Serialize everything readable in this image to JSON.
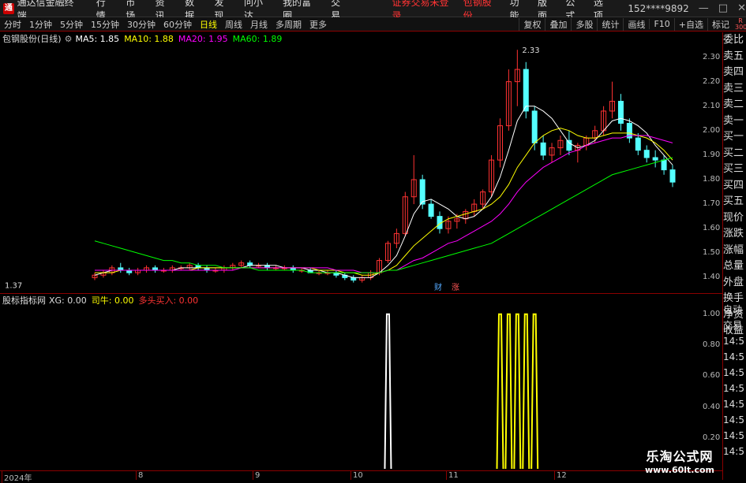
{
  "menubar": {
    "app_name": "通达信金融终端",
    "items": [
      "行情",
      "市场",
      "资讯",
      "数据",
      "发现",
      "问小达",
      "我的富圈",
      "交易"
    ],
    "login_status": "证券交易未登录",
    "stock_name": "包钢股份",
    "right_items": [
      "功能",
      "版面",
      "公式",
      "选项"
    ],
    "phone": "152****9892",
    "window_buttons": [
      "—",
      "□",
      "✕"
    ]
  },
  "tabbar": {
    "periods": [
      "分时",
      "1分钟",
      "5分钟",
      "15分钟",
      "30分钟",
      "60分钟",
      "日线",
      "周线",
      "月线",
      "多周期",
      "更多"
    ],
    "active_period": "日线",
    "tools": [
      "复权",
      "叠加",
      "多股",
      "统计",
      "画线",
      "F10",
      "+自选",
      "标记"
    ],
    "badge": "R 300"
  },
  "main_info": {
    "title": "包钢股份(日线)",
    "ma5": "MA5: 1.85",
    "ma10": "MA10: 1.88",
    "ma20": "MA20: 1.95",
    "ma60": "MA60: 1.89"
  },
  "sub_info": {
    "title": "股标指标网",
    "xg": "XG: 0.00",
    "siniu": "司牛: 0.00",
    "duotou": "多头买入: 0.00"
  },
  "annotations": {
    "high_label": "2.33",
    "low_label": "1.37",
    "cai": "财",
    "zhang": "涨"
  },
  "right_panel": {
    "items": [
      "委比",
      "卖五",
      "卖四",
      "卖三",
      "卖二",
      "卖一",
      "买一",
      "买二",
      "买三",
      "买四",
      "买五",
      "现价",
      "涨跌",
      "涨幅",
      "总量",
      "外盘",
      "换手",
      "净资",
      "收益"
    ],
    "sub_items": [
      "自动",
      "交易",
      "14:5",
      "14:5",
      "14:5",
      "14:5",
      "14:5",
      "14:5",
      "14:5",
      "14:5",
      "14:5"
    ]
  },
  "colors": {
    "up": "#ff3232",
    "down": "#54ffff",
    "ma5": "#ffffff",
    "ma10": "#ffff00",
    "ma20": "#ff00ff",
    "ma60": "#00ff00"
  },
  "y_main": [
    "2.30",
    "2.20",
    "2.10",
    "2.00",
    "1.90",
    "1.80",
    "1.70",
    "1.60",
    "1.50",
    "1.40"
  ],
  "y_sub": [
    "1.00",
    "0.80",
    "0.60",
    "0.40",
    "0.20"
  ],
  "x_axis": [
    "2024年",
    "8",
    "9",
    "10",
    "11",
    "12"
  ],
  "watermark": {
    "line1": "乐淘公式网",
    "line2": "www.60lt.com"
  },
  "chart_data": [
    {
      "type": "candlestick",
      "title": "包钢股份(日线)",
      "ylim": [
        1.34,
        2.35
      ],
      "x_labels": [
        "2024年",
        "8",
        "9",
        "10",
        "11",
        "12"
      ],
      "series": [
        {
          "name": "K线",
          "values": [
            [
              1.4,
              1.42,
              1.39,
              1.41
            ],
            [
              1.41,
              1.43,
              1.4,
              1.42
            ],
            [
              1.42,
              1.45,
              1.41,
              1.44
            ],
            [
              1.44,
              1.46,
              1.42,
              1.43
            ],
            [
              1.43,
              1.44,
              1.41,
              1.42
            ],
            [
              1.42,
              1.44,
              1.41,
              1.43
            ],
            [
              1.43,
              1.45,
              1.42,
              1.44
            ],
            [
              1.44,
              1.45,
              1.42,
              1.43
            ],
            [
              1.43,
              1.44,
              1.42,
              1.43
            ],
            [
              1.43,
              1.45,
              1.42,
              1.44
            ],
            [
              1.44,
              1.45,
              1.43,
              1.44
            ],
            [
              1.44,
              1.46,
              1.43,
              1.45
            ],
            [
              1.45,
              1.46,
              1.43,
              1.44
            ],
            [
              1.44,
              1.45,
              1.42,
              1.43
            ],
            [
              1.43,
              1.44,
              1.42,
              1.43
            ],
            [
              1.43,
              1.45,
              1.42,
              1.44
            ],
            [
              1.44,
              1.46,
              1.43,
              1.45
            ],
            [
              1.45,
              1.47,
              1.44,
              1.46
            ],
            [
              1.46,
              1.47,
              1.44,
              1.45
            ],
            [
              1.45,
              1.46,
              1.44,
              1.45
            ],
            [
              1.45,
              1.46,
              1.43,
              1.44
            ],
            [
              1.44,
              1.45,
              1.43,
              1.44
            ],
            [
              1.44,
              1.45,
              1.43,
              1.44
            ],
            [
              1.44,
              1.45,
              1.42,
              1.43
            ],
            [
              1.43,
              1.44,
              1.42,
              1.43
            ],
            [
              1.43,
              1.44,
              1.42,
              1.42
            ],
            [
              1.42,
              1.43,
              1.41,
              1.42
            ],
            [
              1.42,
              1.43,
              1.41,
              1.42
            ],
            [
              1.42,
              1.43,
              1.4,
              1.41
            ],
            [
              1.41,
              1.42,
              1.39,
              1.4
            ],
            [
              1.4,
              1.41,
              1.38,
              1.39
            ],
            [
              1.39,
              1.41,
              1.38,
              1.4
            ],
            [
              1.4,
              1.43,
              1.39,
              1.42
            ],
            [
              1.42,
              1.48,
              1.41,
              1.47
            ],
            [
              1.47,
              1.55,
              1.46,
              1.54
            ],
            [
              1.54,
              1.6,
              1.52,
              1.58
            ],
            [
              1.58,
              1.75,
              1.57,
              1.73
            ],
            [
              1.73,
              1.9,
              1.7,
              1.8
            ],
            [
              1.8,
              1.82,
              1.68,
              1.7
            ],
            [
              1.7,
              1.72,
              1.64,
              1.65
            ],
            [
              1.65,
              1.67,
              1.58,
              1.6
            ],
            [
              1.6,
              1.65,
              1.58,
              1.63
            ],
            [
              1.63,
              1.66,
              1.6,
              1.64
            ],
            [
              1.64,
              1.68,
              1.62,
              1.67
            ],
            [
              1.67,
              1.72,
              1.65,
              1.7
            ],
            [
              1.7,
              1.76,
              1.68,
              1.75
            ],
            [
              1.75,
              1.9,
              1.73,
              1.88
            ],
            [
              1.88,
              2.05,
              1.85,
              2.02
            ],
            [
              2.02,
              2.25,
              2.0,
              2.2
            ],
            [
              2.2,
              2.33,
              2.1,
              2.25
            ],
            [
              2.25,
              2.28,
              2.05,
              2.08
            ],
            [
              2.08,
              2.1,
              1.92,
              1.95
            ],
            [
              1.95,
              1.98,
              1.88,
              1.9
            ],
            [
              1.9,
              1.95,
              1.87,
              1.93
            ],
            [
              1.93,
              1.98,
              1.9,
              1.96
            ],
            [
              1.96,
              2.0,
              1.9,
              1.92
            ],
            [
              1.92,
              1.95,
              1.87,
              1.94
            ],
            [
              1.94,
              1.98,
              1.92,
              1.97
            ],
            [
              1.97,
              2.02,
              1.95,
              2.0
            ],
            [
              2.0,
              2.1,
              1.98,
              2.08
            ],
            [
              2.08,
              2.2,
              2.05,
              2.12
            ],
            [
              2.12,
              2.15,
              2.0,
              2.03
            ],
            [
              2.03,
              2.05,
              1.95,
              1.97
            ],
            [
              1.97,
              1.99,
              1.9,
              1.92
            ],
            [
              1.92,
              1.94,
              1.87,
              1.89
            ],
            [
              1.89,
              1.92,
              1.85,
              1.88
            ],
            [
              1.88,
              1.9,
              1.82,
              1.84
            ],
            [
              1.84,
              1.86,
              1.77,
              1.79
            ]
          ]
        },
        {
          "name": "MA5",
          "values": [
            1.41,
            1.42,
            1.43,
            1.43,
            1.43,
            1.43,
            1.43,
            1.43,
            1.43,
            1.43,
            1.44,
            1.44,
            1.44,
            1.44,
            1.44,
            1.44,
            1.44,
            1.44,
            1.45,
            1.45,
            1.45,
            1.45,
            1.44,
            1.44,
            1.44,
            1.43,
            1.43,
            1.42,
            1.42,
            1.41,
            1.4,
            1.4,
            1.4,
            1.42,
            1.45,
            1.49,
            1.57,
            1.66,
            1.71,
            1.72,
            1.7,
            1.68,
            1.65,
            1.64,
            1.65,
            1.68,
            1.73,
            1.81,
            1.92,
            2.04,
            2.1,
            2.1,
            2.08,
            2.05,
            2.0,
            1.95,
            1.93,
            1.94,
            1.96,
            2.0,
            2.04,
            2.05,
            2.04,
            2.02,
            1.99,
            1.94,
            1.9,
            1.86
          ]
        },
        {
          "name": "MA10",
          "values": [
            1.42,
            1.42,
            1.42,
            1.43,
            1.43,
            1.43,
            1.43,
            1.43,
            1.43,
            1.43,
            1.43,
            1.43,
            1.44,
            1.44,
            1.44,
            1.44,
            1.44,
            1.44,
            1.44,
            1.44,
            1.44,
            1.44,
            1.44,
            1.44,
            1.44,
            1.44,
            1.43,
            1.43,
            1.43,
            1.42,
            1.42,
            1.41,
            1.41,
            1.42,
            1.43,
            1.45,
            1.49,
            1.53,
            1.56,
            1.59,
            1.62,
            1.64,
            1.65,
            1.66,
            1.67,
            1.68,
            1.7,
            1.73,
            1.78,
            1.85,
            1.9,
            1.95,
            1.98,
            2.0,
            2.01,
            2.0,
            1.98,
            1.97,
            1.97,
            1.98,
            1.99,
            1.99,
            1.99,
            1.98,
            1.97,
            1.95,
            1.92,
            1.88
          ]
        },
        {
          "name": "MA20",
          "values": [
            1.43,
            1.43,
            1.43,
            1.43,
            1.43,
            1.43,
            1.43,
            1.43,
            1.43,
            1.43,
            1.43,
            1.43,
            1.43,
            1.43,
            1.43,
            1.43,
            1.43,
            1.44,
            1.44,
            1.44,
            1.44,
            1.44,
            1.44,
            1.44,
            1.44,
            1.44,
            1.44,
            1.44,
            1.43,
            1.43,
            1.43,
            1.42,
            1.42,
            1.42,
            1.43,
            1.43,
            1.45,
            1.47,
            1.48,
            1.5,
            1.52,
            1.54,
            1.55,
            1.57,
            1.59,
            1.61,
            1.63,
            1.66,
            1.7,
            1.75,
            1.79,
            1.82,
            1.85,
            1.87,
            1.89,
            1.91,
            1.92,
            1.94,
            1.95,
            1.96,
            1.97,
            1.97,
            1.98,
            1.98,
            1.98,
            1.97,
            1.96,
            1.95
          ]
        },
        {
          "name": "MA60",
          "values": [
            1.55,
            1.54,
            1.53,
            1.52,
            1.51,
            1.5,
            1.49,
            1.48,
            1.47,
            1.47,
            1.46,
            1.46,
            1.45,
            1.45,
            1.45,
            1.44,
            1.44,
            1.44,
            1.44,
            1.43,
            1.43,
            1.43,
            1.43,
            1.43,
            1.43,
            1.42,
            1.42,
            1.42,
            1.42,
            1.42,
            1.42,
            1.42,
            1.42,
            1.42,
            1.43,
            1.43,
            1.44,
            1.45,
            1.46,
            1.47,
            1.48,
            1.49,
            1.5,
            1.51,
            1.52,
            1.53,
            1.54,
            1.56,
            1.58,
            1.6,
            1.62,
            1.64,
            1.66,
            1.68,
            1.7,
            1.72,
            1.74,
            1.76,
            1.78,
            1.8,
            1.82,
            1.83,
            1.84,
            1.85,
            1.86,
            1.87,
            1.88,
            1.89
          ]
        }
      ]
    },
    {
      "type": "line",
      "title": "股标指标网",
      "ylim": [
        0,
        1.05
      ],
      "series": [
        {
          "name": "XG",
          "spikes": [
            34
          ]
        },
        {
          "name": "多头买入",
          "spikes": [
            47,
            48,
            49,
            50,
            51
          ]
        }
      ]
    }
  ]
}
